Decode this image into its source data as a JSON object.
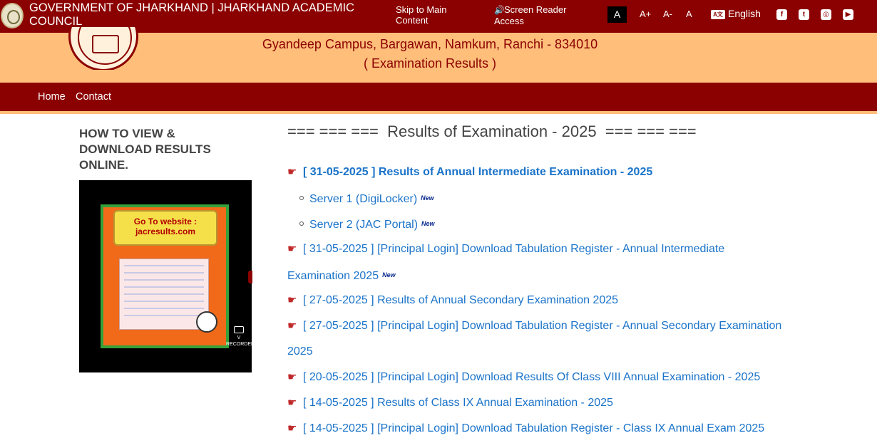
{
  "topbar": {
    "gov_title": "GOVERNMENT OF JHARKHAND | JHARKHAND ACADEMIC COUNCIL",
    "skip_link": "Skip to Main Content",
    "screen_reader": "Screen Reader Access",
    "font_normal_active": "A",
    "font_increase": "A+",
    "font_decrease": "A-",
    "font_reset": "A",
    "language": "English",
    "language_icon_text": "A文",
    "social": [
      {
        "name": "facebook-icon",
        "glyph": "f"
      },
      {
        "name": "twitter-icon",
        "glyph": "t"
      },
      {
        "name": "instagram-icon",
        "glyph": "◎"
      },
      {
        "name": "youtube-icon",
        "glyph": "▶"
      }
    ]
  },
  "header": {
    "address": "Gyandeep Campus, Bargawan, Namkum, Ranchi - 834010",
    "subtitle": "( Examination Results )"
  },
  "nav": {
    "home": "Home",
    "contact": "Contact"
  },
  "sidebar": {
    "title": "HOW TO VIEW & DOWNLOAD RESULTS ONLINE.",
    "video": {
      "scroll_line1": "Go To website :",
      "scroll_line2": "jacresults.com",
      "recorder_label": "V RECORDER"
    }
  },
  "main": {
    "title": "=== === ===  Results of Examination - 2025  === === ===",
    "results": [
      {
        "date": "[ 31-05-2025 ]",
        "text": "Results of Annual Intermediate Examination - 2025",
        "bold": true
      },
      {
        "date": "[ 31-05-2025 ]",
        "text": "[Principal Login] Download Tabulation Register - Annual Intermediate Examination 2025",
        "new": true
      },
      {
        "date": "[ 27-05-2025 ]",
        "text": "Results of Annual Secondary Examination 2025"
      },
      {
        "date": "[ 27-05-2025 ]",
        "text": "[Principal Login] Download Tabulation Register - Annual Secondary Examination 2025"
      },
      {
        "date": "[ 20-05-2025 ]",
        "text": "[Principal Login] Download Results Of Class VIII Annual Examination - 2025"
      },
      {
        "date": "[ 14-05-2025 ]",
        "text": "Results of Class IX Annual Examination - 2025"
      },
      {
        "date": "[ 14-05-2025 ]",
        "text": "[Principal Login] Download Tabulation Register - Class IX Annual Exam 2025"
      }
    ],
    "servers": [
      {
        "label": "Server 1 (DigiLocker)",
        "badge": "New"
      },
      {
        "label": "Server 2 (JAC Portal)",
        "badge": "New"
      }
    ],
    "new_badge": "New"
  },
  "colors": {
    "brand_maroon": "#8b0000",
    "header_peach": "#ffbe7a",
    "link_blue": "#1a73c9",
    "hand_red": "#c0292a"
  }
}
